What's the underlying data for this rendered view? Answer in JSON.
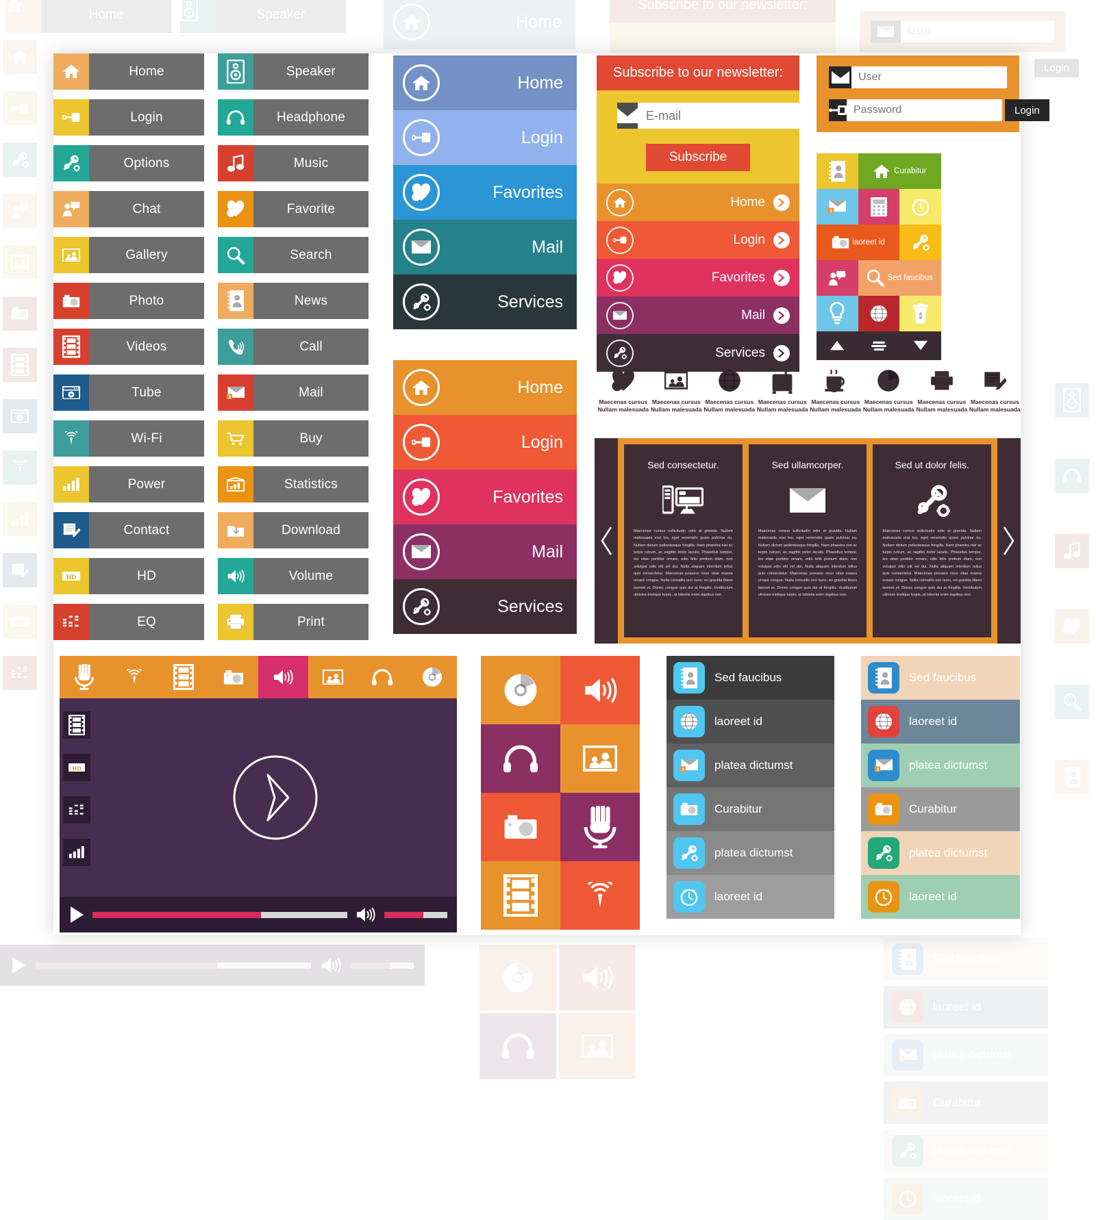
{
  "menu_list": {
    "left_column": [
      {
        "label": "Home",
        "icon": "home-icon",
        "color": "#f0ac5e"
      },
      {
        "label": "Login",
        "icon": "key-icon",
        "color": "#ecc52f"
      },
      {
        "label": "Options",
        "icon": "wrench-gear-icon",
        "color": "#23a897"
      },
      {
        "label": "Chat",
        "icon": "chat-icon",
        "color": "#f0ac5e"
      },
      {
        "label": "Gallery",
        "icon": "gallery-icon",
        "color": "#ecc52f"
      },
      {
        "label": "Photo",
        "icon": "camera-icon",
        "color": "#d7402f"
      },
      {
        "label": "Videos",
        "icon": "film-icon",
        "color": "#d7402f"
      },
      {
        "label": "Tube",
        "icon": "video-player-icon",
        "color": "#1f5c8b"
      },
      {
        "label": "Wi-Fi",
        "icon": "wifi-icon",
        "color": "#3d9e9b"
      },
      {
        "label": "Power",
        "icon": "bars-icon",
        "color": "#ecc52f"
      },
      {
        "label": "Contact",
        "icon": "document-pen-icon",
        "color": "#1f5c8b"
      },
      {
        "label": "HD",
        "icon": "hd-icon",
        "color": "#ecc52f"
      },
      {
        "label": "EQ",
        "icon": "equalizer-icon",
        "color": "#d7402f"
      }
    ],
    "right_column": [
      {
        "label": "Speaker",
        "icon": "speaker-icon",
        "color": "#3d9e9b"
      },
      {
        "label": "Headphone",
        "icon": "headphone-icon",
        "color": "#23a897"
      },
      {
        "label": "Music",
        "icon": "music-note-icon",
        "color": "#d7402f"
      },
      {
        "label": "Favorite",
        "icon": "heart-plus-icon",
        "color": "#ea9312"
      },
      {
        "label": "Search",
        "icon": "magnifier-icon",
        "color": "#23a897"
      },
      {
        "label": "News",
        "icon": "contact-book-icon",
        "color": "#f0ac5e"
      },
      {
        "label": "Call",
        "icon": "phone-icon",
        "color": "#3d9e9b"
      },
      {
        "label": "Mail",
        "icon": "mail-badge-icon",
        "color": "#d7402f"
      },
      {
        "label": "Buy",
        "icon": "cart-icon",
        "color": "#ecc52f"
      },
      {
        "label": "Statistics",
        "icon": "stats-icon",
        "color": "#ea9312"
      },
      {
        "label": "Download",
        "icon": "download-folder-icon",
        "color": "#f0ac5e"
      },
      {
        "label": "Volume",
        "icon": "volume-icon",
        "color": "#23a897"
      },
      {
        "label": "Print",
        "icon": "printer-icon",
        "color": "#ecc52f"
      }
    ]
  },
  "nav_blue": {
    "items": [
      {
        "label": "Home",
        "icon": "home-icon",
        "color": "#7391c4"
      },
      {
        "label": "Login",
        "icon": "key-icon",
        "color": "#92b2ee"
      },
      {
        "label": "Favorites",
        "icon": "heart-plus-icon",
        "color": "#2b95d6"
      },
      {
        "label": "Mail",
        "icon": "mail-icon",
        "color": "#25818a"
      },
      {
        "label": "Services",
        "icon": "wrench-gear-icon",
        "color": "#29373a"
      }
    ]
  },
  "nav_warm": {
    "items": [
      {
        "label": "Home",
        "icon": "home-icon",
        "color": "#e8922e"
      },
      {
        "label": "Login",
        "icon": "key-icon",
        "color": "#ef5935"
      },
      {
        "label": "Favorites",
        "icon": "heart-plus-icon",
        "color": "#e0325f"
      },
      {
        "label": "Mail",
        "icon": "mail-icon",
        "color": "#8c2f63"
      },
      {
        "label": "Services",
        "icon": "wrench-gear-icon",
        "color": "#3e2d35"
      }
    ]
  },
  "newsletter": {
    "heading": "Subscribe to our newsletter:",
    "email_placeholder": "E-mail",
    "email_value": "",
    "button_label": "Subscribe",
    "icon": "mail-icon",
    "accent": "#e04a34",
    "background": "#ecc52f"
  },
  "arrow_nav": {
    "items": [
      {
        "label": "Home",
        "icon": "home-icon",
        "color": "#e8922e",
        "chevron": "chevron-right-icon"
      },
      {
        "label": "Login",
        "icon": "key-icon",
        "color": "#ef5935",
        "chevron": "chevron-right-icon"
      },
      {
        "label": "Favorites",
        "icon": "heart-plus-icon",
        "color": "#e0325f",
        "chevron": "chevron-right-icon"
      },
      {
        "label": "Mail",
        "icon": "mail-icon",
        "color": "#8c2f63",
        "chevron": "chevron-right-icon"
      },
      {
        "label": "Services",
        "icon": "wrench-gear-icon",
        "color": "#3e2d35",
        "chevron": "chevron-right-icon"
      }
    ]
  },
  "login_box": {
    "background": "#e8922e",
    "user_placeholder": "User",
    "user_value": "",
    "user_icon": "mail-icon",
    "password_placeholder": "Password",
    "password_value": "",
    "password_icon": "key-icon",
    "button_label": "Login"
  },
  "tile_grid": {
    "tiles": [
      {
        "icon": "contact-book-icon",
        "label": "",
        "color": "#ecc52f",
        "span": 1
      },
      {
        "icon": "home-icon",
        "label": "Curabitur",
        "color": "#6fa821",
        "span": 2
      },
      {
        "icon": "mail-badge-icon",
        "label": "",
        "color": "#6ec6e8",
        "span": 1
      },
      {
        "icon": "calculator-icon",
        "label": "",
        "color": "#d63f69",
        "span": 1
      },
      {
        "icon": "clock-icon",
        "label": "",
        "color": "#f7ea6a",
        "span": 1
      },
      {
        "icon": "camera-icon",
        "label": "laoreet id",
        "color": "#e8591b",
        "span": 2
      },
      {
        "icon": "wrench-gear-icon",
        "label": "",
        "color": "#f9bb16",
        "span": 1
      },
      {
        "icon": "chat-icon",
        "label": "",
        "color": "#d63f69",
        "span": 1
      },
      {
        "icon": "magnifier-icon",
        "label": "Sed faucibus",
        "color": "#f2a268",
        "span": 2
      },
      {
        "icon": "bulb-icon",
        "label": "",
        "color": "#6ec6e8",
        "span": 1
      },
      {
        "icon": "globe-icon",
        "label": "",
        "color": "#b9272d",
        "span": 1
      },
      {
        "icon": "trash-icon",
        "label": "",
        "color": "#f7ea6a",
        "span": 1
      }
    ],
    "toolbar": [
      "triangle-up-icon",
      "menu-lines-icon",
      "triangle-down-icon"
    ],
    "toolbar_color": "#3a2b33"
  },
  "icon_captions": {
    "items": [
      {
        "icon": "heart-plus-icon",
        "line1": "Maecenas  cursus",
        "line2": "Nullam malesuada"
      },
      {
        "icon": "gallery-icon",
        "line1": "Maecenas  cursus",
        "line2": "Nullam malesuada"
      },
      {
        "icon": "globe-icon",
        "line1": "Maecenas  cursus",
        "line2": "Nullam malesuada"
      },
      {
        "icon": "luggage-icon",
        "line1": "Maecenas  cursus",
        "line2": "Nullam malesuada"
      },
      {
        "icon": "coffee-icon",
        "line1": "Maecenas  cursus",
        "line2": "Nullam malesuada"
      },
      {
        "icon": "pie-chart-icon",
        "line1": "Maecenas  cursus",
        "line2": "Nullam malesuada"
      },
      {
        "icon": "printer-icon",
        "line1": "Maecenas  cursus",
        "line2": "Nullam malesuada"
      },
      {
        "icon": "document-pen-icon",
        "line1": "Maecenas  cursus",
        "line2": "Nullam malesuada"
      }
    ]
  },
  "carousel": {
    "frame_color": "#e8922e",
    "card_color": "#3e2d35",
    "prev_icon": "chevron-left-icon",
    "next_icon": "chevron-right-icon",
    "body_text": "Maecenas cursus sollicitudin odio at gravida. Nullam malesuada erat leo, eget venenatis quam pulvinar eu. Nullam dictum pellentesque fringilla. Nam pharetra nisl ac turpis rutrum, ac sagittis tortor iaculis. Phasellus tempor, leo vitae porttitor ornare, odio felis pretium diam, non volutpat odio elit vel dui. Nulla aliquam interdum tellus quis consectetur. Maecenas posuere risus vitae massa ornare congue. Nulla convallis orci nunc, eu gravida libero laoreet et. Donec congue quis dui at fringilla. Vestibulum ultricies tristique turpis, at lobortis enim dapibus non.",
    "cards": [
      {
        "title": "Sed consectetur.",
        "icon": "desktop-icon"
      },
      {
        "title": "Sed ullamcorper.",
        "icon": "mail-icon"
      },
      {
        "title": "Sed ut dolor felis.",
        "icon": "wrench-gear-icon"
      }
    ]
  },
  "media_player": {
    "toolbar": [
      {
        "icon": "microphone-icon",
        "active": false
      },
      {
        "icon": "wifi-icon",
        "active": false
      },
      {
        "icon": "film-icon",
        "active": false
      },
      {
        "icon": "camera-icon",
        "active": false
      },
      {
        "icon": "volume-icon",
        "active": true
      },
      {
        "icon": "gallery-icon",
        "active": false
      },
      {
        "icon": "headphone-icon",
        "active": false
      },
      {
        "icon": "disc-icon",
        "active": false
      }
    ],
    "sidebar": [
      "film-icon",
      "hd-icon",
      "equalizer-icon",
      "bars-icon"
    ],
    "stage_icon": "play-circle-icon",
    "play_icon": "play-icon",
    "volume_icon": "volume-icon",
    "progress_percent": 66,
    "volume_percent": 62,
    "screen_color": "#472e50",
    "bar_color": "#2d1c34",
    "accent": "#d92b5c",
    "toolbar_color": "#e8922e",
    "toolbar_active_color": "#d62f6b"
  },
  "tile_grid_2": {
    "tiles": [
      {
        "icon": "disc-icon",
        "color": "#e8922e"
      },
      {
        "icon": "volume-icon",
        "color": "#ef5935"
      },
      {
        "icon": "headphone-icon",
        "color": "#8c2f63"
      },
      {
        "icon": "gallery-icon",
        "color": "#e8922e"
      },
      {
        "icon": "camera-icon",
        "color": "#ef5935"
      },
      {
        "icon": "microphone-icon",
        "color": "#8c2f63"
      },
      {
        "icon": "film-icon",
        "color": "#e8922e"
      },
      {
        "icon": "wifi-icon",
        "color": "#ef5935"
      }
    ]
  },
  "dark_list": {
    "items": [
      {
        "label": "Sed faucibus",
        "icon": "contact-book-icon",
        "icon_color": "#4fc7f0",
        "row_color": "#3b3b3b",
        "text_color": "#ffffff"
      },
      {
        "label": "laoreet id",
        "icon": "globe-icon",
        "icon_color": "#4fc7f0",
        "row_color": "#4f4f4f",
        "text_color": "#ffffff"
      },
      {
        "label": "platea  dictumst",
        "icon": "mail-badge-icon",
        "icon_color": "#4fc7f0",
        "row_color": "#606060",
        "text_color": "#ffffff"
      },
      {
        "label": "Curabitur",
        "icon": "camera-icon",
        "icon_color": "#4fc7f0",
        "row_color": "#757575",
        "text_color": "#ffffff"
      },
      {
        "label": "platea  dictumst",
        "icon": "wrench-gear-icon",
        "icon_color": "#4fc7f0",
        "row_color": "#8a8a8a",
        "text_color": "#ffffff"
      },
      {
        "label": "laoreet id",
        "icon": "clock-icon",
        "icon_color": "#4fc7f0",
        "row_color": "#9e9e9e",
        "text_color": "#ffffff"
      }
    ]
  },
  "color_list": {
    "items": [
      {
        "label": "Sed faucibus",
        "icon": "contact-book-icon",
        "icon_color": "#2e8ccd",
        "row_color": "#f2d4b8",
        "text_color": "#ffffff"
      },
      {
        "label": "laoreet id",
        "icon": "globe-icon",
        "icon_color": "#e2413c",
        "row_color": "#6b8799",
        "text_color": "#ffffff"
      },
      {
        "label": "platea  dictumst",
        "icon": "mail-badge-icon",
        "icon_color": "#2e8ccd",
        "row_color": "#9ecfb3",
        "text_color": "#ffffff"
      },
      {
        "label": "Curabitur",
        "icon": "camera-icon",
        "icon_color": "#ea9312",
        "row_color": "#9b9b9b",
        "text_color": "#ffffff"
      },
      {
        "label": "platea  dictumst",
        "icon": "wrench-gear-icon",
        "icon_color": "#23a87a",
        "row_color": "#f2d4b8",
        "text_color": "#ffffff"
      },
      {
        "label": "laoreet id",
        "icon": "clock-icon",
        "icon_color": "#ea9312",
        "row_color": "#9ecfb3",
        "text_color": "#ffffff"
      }
    ]
  }
}
